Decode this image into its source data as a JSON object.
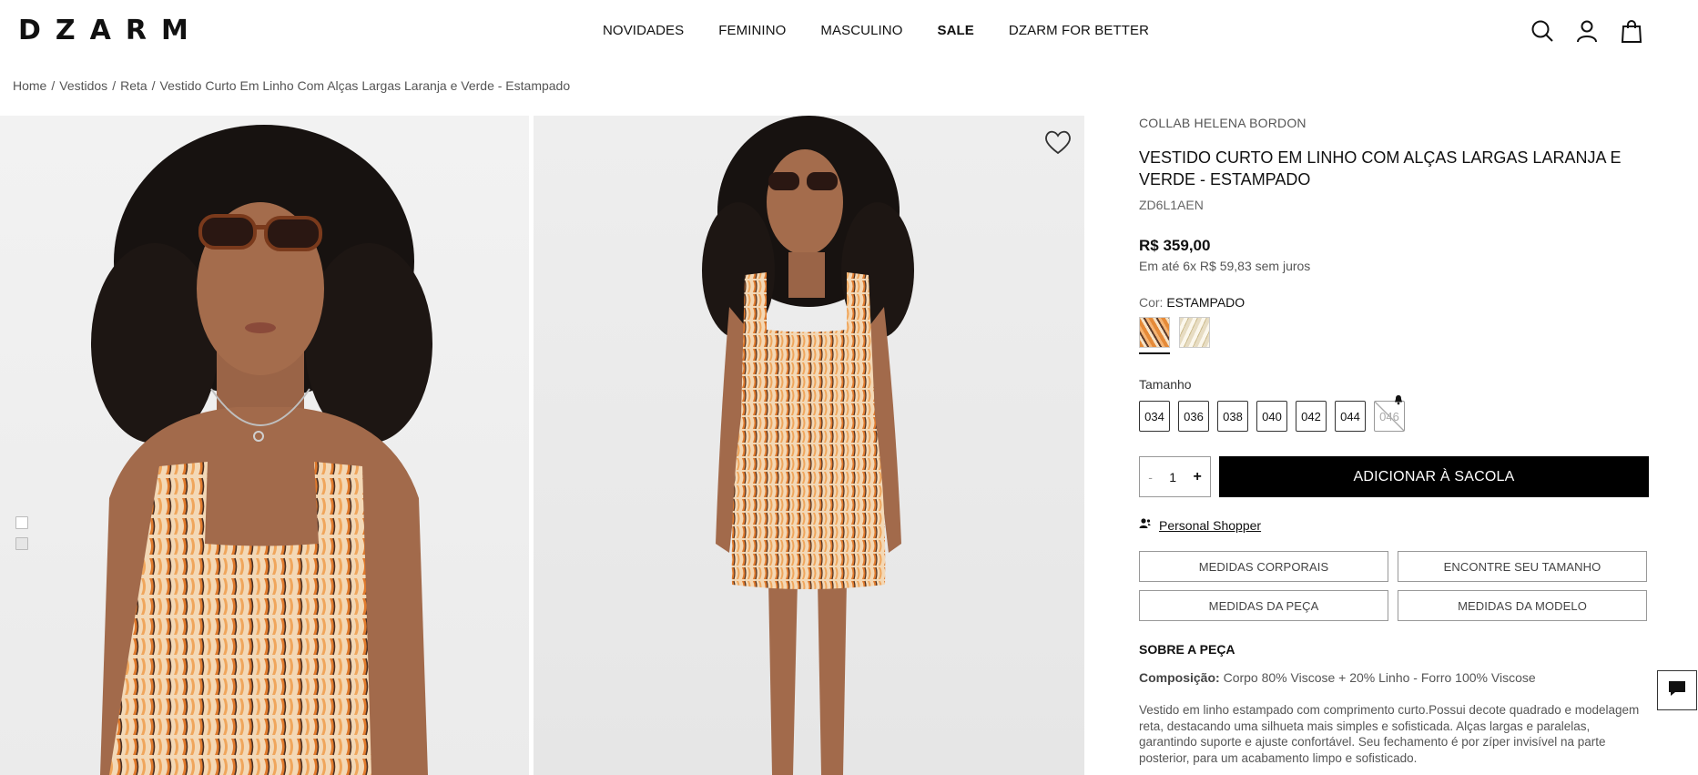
{
  "header": {
    "logo": "DZARM",
    "nav": [
      {
        "label": "NOVIDADES",
        "bold": false
      },
      {
        "label": "FEMININO",
        "bold": false
      },
      {
        "label": "MASCULINO",
        "bold": false
      },
      {
        "label": "SALE",
        "bold": true
      },
      {
        "label": "DZARM FOR BETTER",
        "bold": false
      }
    ],
    "icons": [
      "search-icon",
      "user-icon",
      "bag-icon"
    ]
  },
  "breadcrumb": [
    {
      "label": "Home"
    },
    {
      "label": "Vestidos"
    },
    {
      "label": "Reta"
    },
    {
      "label": "Vestido Curto Em Linho Com Alças Largas Laranja e Verde - Estampado"
    }
  ],
  "product": {
    "brand": "COLLAB HELENA BORDON",
    "title": "VESTIDO CURTO EM LINHO COM ALÇAS LARGAS LARANJA E VERDE - ESTAMPADO",
    "sku": "ZD6L1AEN",
    "price": "R$ 359,00",
    "installment": "Em até 6x R$ 59,83 sem juros",
    "color_label": "Cor:",
    "color_value": "ESTAMPADO",
    "size_label": "Tamanho",
    "sizes": [
      {
        "label": "034",
        "available": true
      },
      {
        "label": "036",
        "available": true
      },
      {
        "label": "038",
        "available": true
      },
      {
        "label": "040",
        "available": true
      },
      {
        "label": "042",
        "available": true
      },
      {
        "label": "044",
        "available": true
      },
      {
        "label": "046",
        "available": false
      }
    ],
    "quantity": {
      "minus": "-",
      "value": "1",
      "plus": "+"
    },
    "add_to_bag": "ADICIONAR À SACOLA",
    "personal_shopper": "Personal Shopper",
    "measure_buttons": [
      "MEDIDAS CORPORAIS",
      "ENCONTRE SEU TAMANHO",
      "MEDIDAS DA PEÇA",
      "MEDIDAS DA MODELO"
    ],
    "about_title": "SOBRE A PEÇA",
    "composition_label": "Composição:",
    "composition_value": "Corpo 80% Viscose + 20% Linho - Forro 100% Viscose",
    "description": "Vestido em linho estampado com comprimento curto.Possui decote quadrado e modelagem reta, destacando uma silhueta mais simples e sofisticada. Alças largas e paralelas, garantindo suporte e ajuste confortável. Seu fechamento é por zíper invisível na parte posterior, para um acabamento limpo e sofisticado."
  },
  "colors": {
    "accent": "#000000",
    "text": "#111111",
    "muted": "#555555"
  }
}
